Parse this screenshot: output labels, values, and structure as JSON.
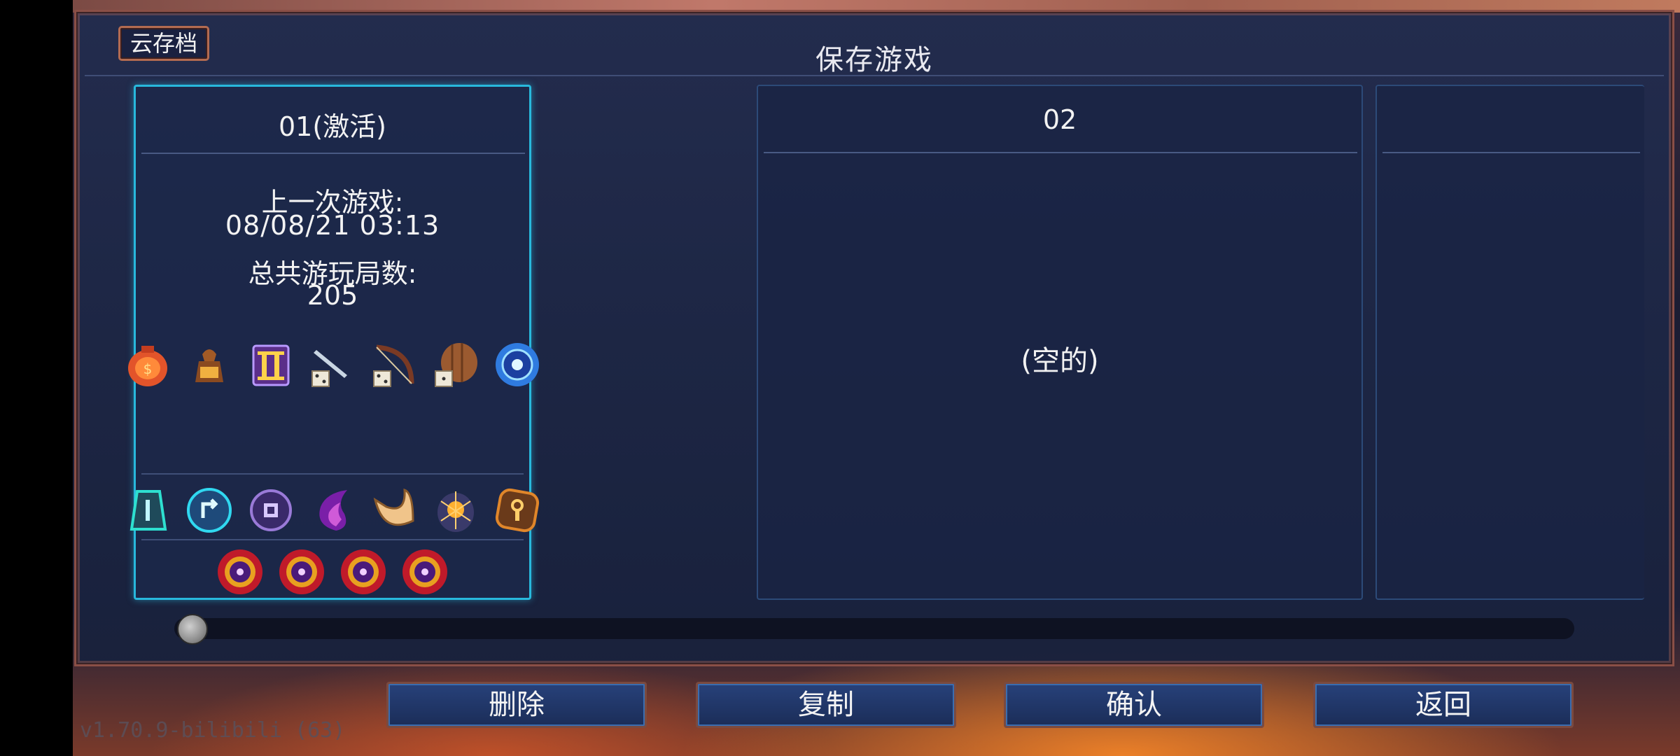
{
  "window": {
    "title": "保存游戏"
  },
  "cloud_save": {
    "label": "云存档"
  },
  "slots": [
    {
      "title": "01(激活)",
      "last_played_label": "上一次游戏:",
      "last_played_value": "08/08/21  03:13",
      "runs_label": "总共游玩局数:",
      "runs_value": "205",
      "row1_icons": [
        "orange-pouch-icon",
        "bronze-money-bag-icon",
        "roman-numeral-two-scroll-icon",
        "sword-dice-icon",
        "bow-dice-icon",
        "wooden-shield-dice-icon",
        "blue-orb-icon"
      ],
      "row2_icons": [
        "cyan-rune-icon",
        "cyan-arrow-rune-icon",
        "purple-eye-rune-icon",
        "purple-flame-icon",
        "horn-icon",
        "spider-egg-icon",
        "orange-key-rune-icon"
      ],
      "row3_icons": [
        "red-boss-cell-icon",
        "red-boss-cell-icon",
        "red-boss-cell-icon",
        "red-boss-cell-icon"
      ]
    },
    {
      "title": "02",
      "empty_label": "(空的)"
    },
    {
      "title": ""
    }
  ],
  "buttons": {
    "delete": "删除",
    "copy": "复制",
    "confirm": "确认",
    "back": "返回"
  },
  "version": "v1.70.9-bilibili (63)",
  "colors": {
    "active_border": "#28b8dc",
    "panel_border": "#8a4f46",
    "button_fill": "#27417a"
  }
}
